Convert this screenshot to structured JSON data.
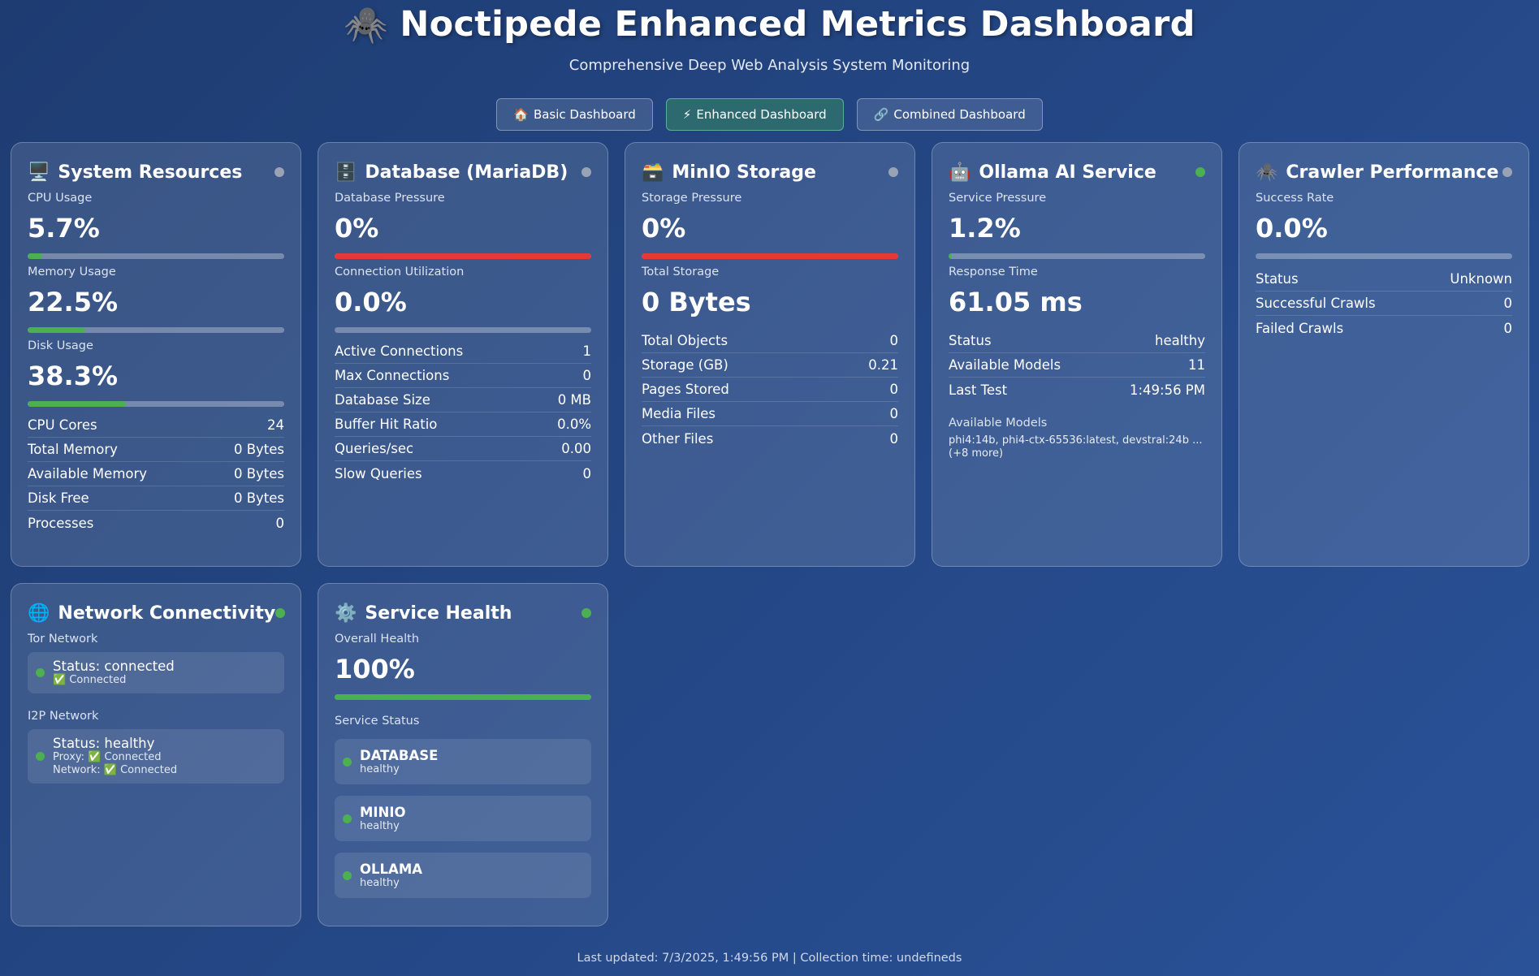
{
  "header": {
    "logo_icon": "spider-icon",
    "title": "Noctipede Enhanced Metrics Dashboard",
    "subtitle": "Comprehensive Deep Web Analysis System Monitoring"
  },
  "nav": {
    "basic": {
      "icon": "🏠",
      "label": "Basic Dashboard"
    },
    "enhanced": {
      "icon": "⚡",
      "label": "Enhanced Dashboard"
    },
    "combined": {
      "icon": "🔗",
      "label": "Combined Dashboard"
    }
  },
  "colors": {
    "accent_green": "#4caf50",
    "alert_red": "#e53935",
    "status_grey": "#9aa3b5"
  },
  "system": {
    "icon": "🖥️",
    "title": "System Resources",
    "cpu_label": "CPU Usage",
    "cpu_value": "5.7%",
    "cpu_fraction": 0.057,
    "mem_label": "Memory Usage",
    "mem_value": "22.5%",
    "mem_fraction": 0.225,
    "disk_label": "Disk Usage",
    "disk_value": "38.3%",
    "disk_fraction": 0.383,
    "rows": [
      {
        "label": "CPU Cores",
        "value": "24"
      },
      {
        "label": "Total Memory",
        "value": "0 Bytes"
      },
      {
        "label": "Available Memory",
        "value": "0 Bytes"
      },
      {
        "label": "Disk Free",
        "value": "0 Bytes"
      },
      {
        "label": "Processes",
        "value": "0"
      }
    ]
  },
  "database": {
    "icon": "🗄️",
    "title": "Database (MariaDB)",
    "pressure_label": "Database Pressure",
    "pressure_value": "0%",
    "pressure_fraction": 1.0,
    "conn_label": "Connection Utilization",
    "conn_value": "0.0%",
    "conn_fraction": 0.0,
    "rows": [
      {
        "label": "Active Connections",
        "value": "1"
      },
      {
        "label": "Max Connections",
        "value": "0"
      },
      {
        "label": "Database Size",
        "value": "0 MB"
      },
      {
        "label": "Buffer Hit Ratio",
        "value": "0.0%"
      },
      {
        "label": "Queries/sec",
        "value": "0.00"
      },
      {
        "label": "Slow Queries",
        "value": "0"
      }
    ]
  },
  "minio": {
    "icon": "🗃️",
    "title": "MinIO Storage",
    "pressure_label": "Storage Pressure",
    "pressure_value": "0%",
    "pressure_fraction": 1.0,
    "total_label": "Total Storage",
    "total_value": "0 Bytes",
    "rows": [
      {
        "label": "Total Objects",
        "value": "0"
      },
      {
        "label": "Storage (GB)",
        "value": "0.21"
      },
      {
        "label": "Pages Stored",
        "value": "0"
      },
      {
        "label": "Media Files",
        "value": "0"
      },
      {
        "label": "Other Files",
        "value": "0"
      }
    ]
  },
  "ollama": {
    "icon": "🤖",
    "title": "Ollama AI Service",
    "pressure_label": "Service Pressure",
    "pressure_value": "1.2%",
    "pressure_fraction": 0.012,
    "resp_label": "Response Time",
    "resp_value": "61.05 ms",
    "rows": [
      {
        "label": "Status",
        "value": "healthy"
      },
      {
        "label": "Available Models",
        "value": "11"
      },
      {
        "label": "Last Test",
        "value": "1:49:56 PM"
      }
    ],
    "models_label": "Available Models",
    "models_text": "phi4:14b, phi4-ctx-65536:latest, devstral:24b ... (+8 more)"
  },
  "crawler": {
    "icon": "🕷️",
    "title": "Crawler Performance",
    "success_label": "Success Rate",
    "success_value": "0.0%",
    "success_fraction": 0.0,
    "rows": [
      {
        "label": "Status",
        "value": "Unknown"
      },
      {
        "label": "Successful Crawls",
        "value": "0"
      },
      {
        "label": "Failed Crawls",
        "value": "0"
      }
    ]
  },
  "network": {
    "icon": "🌐",
    "title": "Network Connectivity",
    "tor_label": "Tor Network",
    "tor_status": "Status: connected",
    "tor_sub": "✅ Connected",
    "i2p_label": "I2P Network",
    "i2p_status": "Status: healthy",
    "i2p_proxy": "Proxy: ✅ Connected",
    "i2p_network": "Network: ✅ Connected"
  },
  "health": {
    "icon": "⚙️",
    "title": "Service Health",
    "overall_label": "Overall Health",
    "overall_value": "100%",
    "overall_fraction": 1.0,
    "status_label": "Service Status",
    "services": [
      {
        "name": "DATABASE",
        "state": "healthy"
      },
      {
        "name": "MINIO",
        "state": "healthy"
      },
      {
        "name": "OLLAMA",
        "state": "healthy"
      }
    ]
  },
  "footer": {
    "text": "Last updated: 7/3/2025, 1:49:56 PM | Collection time: undefineds"
  }
}
